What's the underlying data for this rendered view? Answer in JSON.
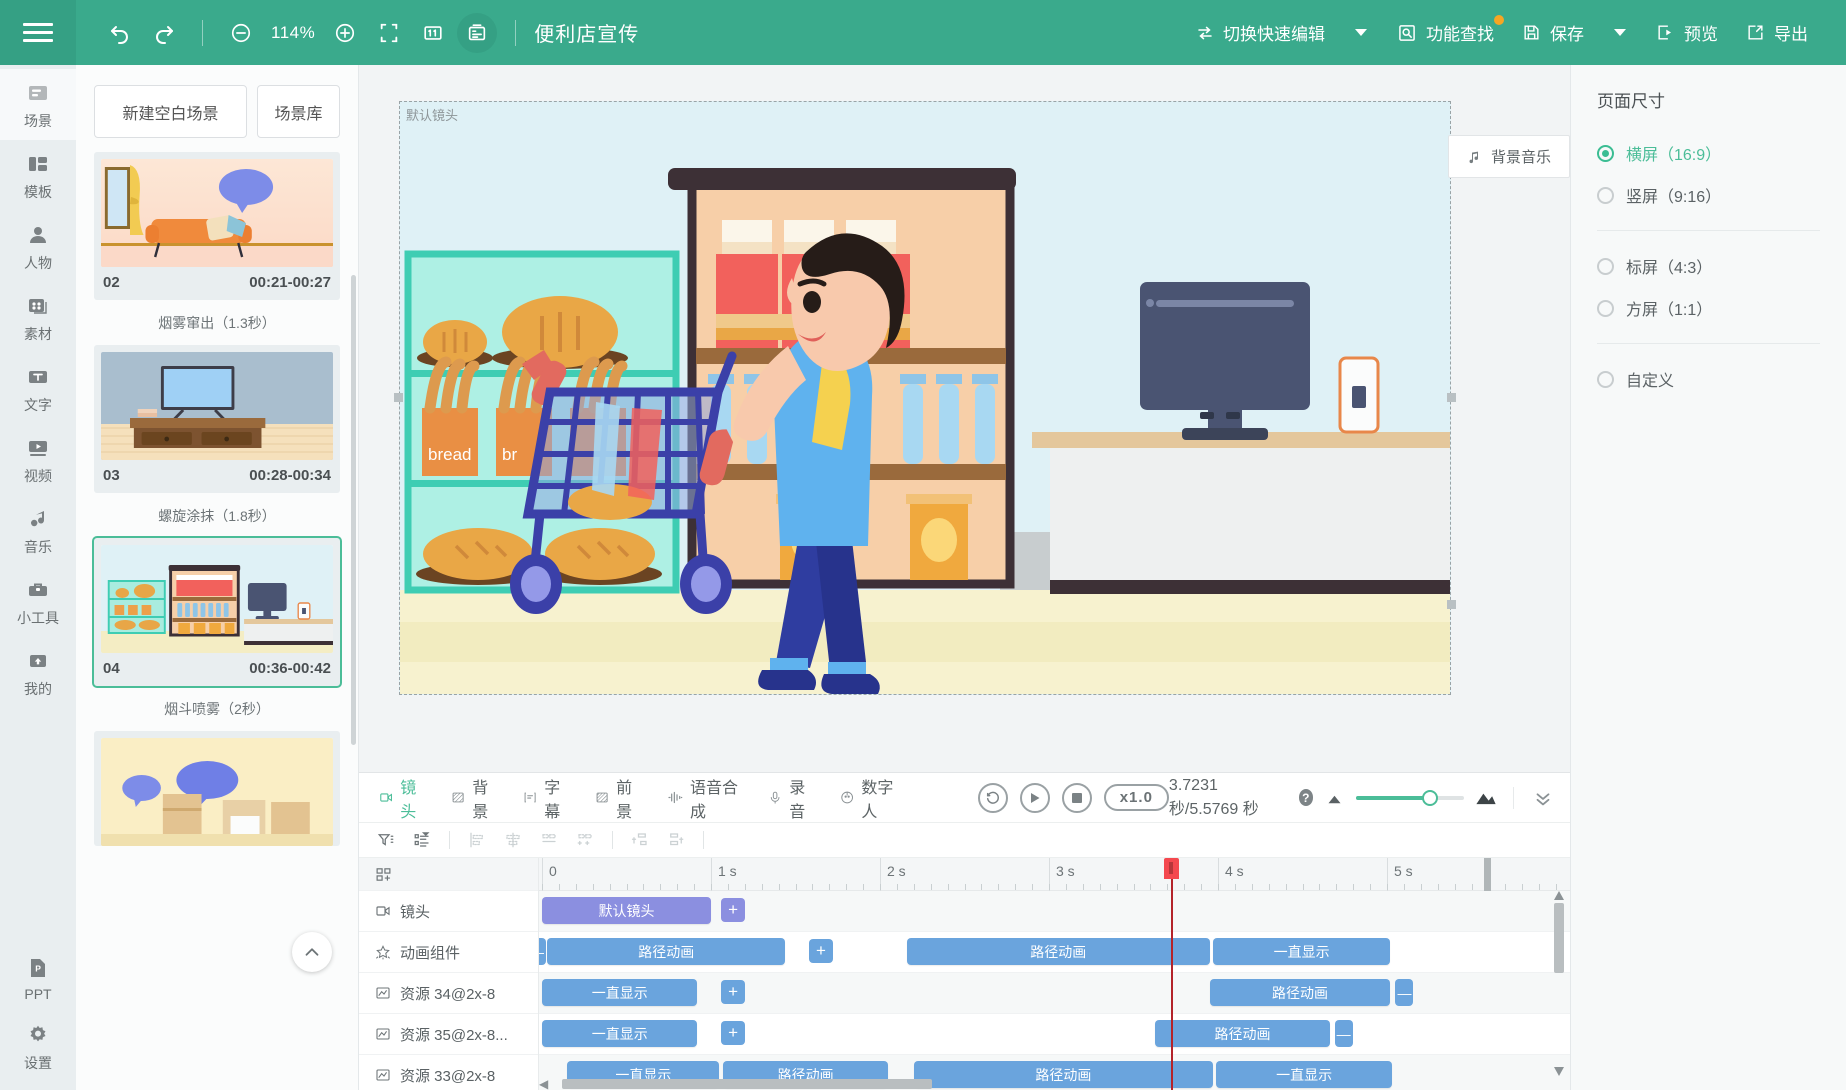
{
  "topbar": {
    "menu_icon": "hamburger-icon",
    "undo_icon": "undo-icon",
    "redo_icon": "redo-icon",
    "zoom_out_icon": "zoom-out-icon",
    "zoom_level": "114%",
    "zoom_in_icon": "zoom-in-icon",
    "fullscreen_icon": "fit-screen-icon",
    "one_to_one_icon": "actual-size-icon",
    "grid_icon": "storyboard-icon",
    "doc_title": "便利店宣传",
    "quick_edit": "切换快速编辑",
    "feature_search": "功能查找",
    "save": "保存",
    "preview": "预览",
    "export": "导出"
  },
  "rail": {
    "items": [
      {
        "label": "场景",
        "icon": "scene-icon"
      },
      {
        "label": "模板",
        "icon": "template-icon"
      },
      {
        "label": "人物",
        "icon": "person-icon"
      },
      {
        "label": "素材",
        "icon": "material-icon"
      },
      {
        "label": "文字",
        "icon": "text-icon"
      },
      {
        "label": "视频",
        "icon": "video-icon"
      },
      {
        "label": "音乐",
        "icon": "music-icon"
      },
      {
        "label": "小工具",
        "icon": "toolbox-icon"
      },
      {
        "label": "我的",
        "icon": "upload-icon"
      }
    ],
    "bottom": [
      {
        "label": "PPT",
        "icon": "ppt-icon"
      },
      {
        "label": "设置",
        "icon": "gear-icon"
      }
    ]
  },
  "scenes": {
    "new_blank": "新建空白场景",
    "library": "场景库",
    "items": [
      {
        "number": "02",
        "time": "00:21-00:27",
        "transition": "烟雾窜出（1.3秒）",
        "selected": false
      },
      {
        "number": "03",
        "time": "00:28-00:34",
        "transition": "螺旋涂抹（1.8秒）",
        "selected": false
      },
      {
        "number": "04",
        "time": "00:36-00:42",
        "transition": "烟斗喷雾（2秒）",
        "selected": true
      }
    ]
  },
  "stage": {
    "bgm_label": "背景音乐",
    "bgm_icon": "music-note-icon",
    "camera_label": "默认镜头"
  },
  "timeline": {
    "tabs": [
      {
        "label": "镜头",
        "icon": "camera-icon",
        "active": true
      },
      {
        "label": "背景",
        "icon": "background-icon",
        "active": false
      },
      {
        "label": "字幕",
        "icon": "subtitle-icon",
        "active": false
      },
      {
        "label": "前景",
        "icon": "foreground-icon",
        "active": false
      },
      {
        "label": "语音合成",
        "icon": "tts-icon",
        "active": false
      },
      {
        "label": "录音",
        "icon": "microphone-icon",
        "active": false
      },
      {
        "label": "数字人",
        "icon": "digital-human-icon",
        "active": false
      }
    ],
    "transport": {
      "replay_icon": "replay-icon",
      "play_icon": "play-icon",
      "stop_icon": "stop-icon",
      "speed": "x1.0"
    },
    "time_current": "3.7231 秒",
    "time_total": "5.5769 秒",
    "time_readout": "3.7231 秒/5.5769 秒",
    "help_icon": "question-icon",
    "zoom_small_icon": "small-hill-icon",
    "zoom_large_icon": "large-hill-icon",
    "collapse_icon": "double-chevron-down-icon",
    "tools": [
      "filter-tracks-icon",
      "group-tracks-icon",
      "align-left-icon",
      "align-center-icon",
      "align-right-icon",
      "distribute-icon",
      "nest-up-icon",
      "nest-down-icon"
    ],
    "ruler": {
      "labels": [
        "0",
        "1 s",
        "2 s",
        "3 s",
        "4 s",
        "5 s"
      ],
      "playhead_time": 3.7231
    },
    "header_row_icon": "track-group-icon",
    "tracks": [
      {
        "name": "镜头",
        "icon": "camera-track-icon",
        "clips": [
          {
            "label": "默认镜头",
            "start": 0.0,
            "end": 1.0,
            "kind": "cam"
          }
        ],
        "add_button": {
          "at": 1.06,
          "kind": "cam"
        }
      },
      {
        "name": "动画组件",
        "icon": "star-track-icon",
        "handles": [
          {
            "at": 0.0,
            "side": "left"
          }
        ],
        "clips": [
          {
            "label": "路径动画",
            "start": 0.03,
            "end": 1.44,
            "kind": "anim"
          },
          {
            "label": "路径动画",
            "start": 2.16,
            "end": 3.95,
            "kind": "anim"
          },
          {
            "label": "一直显示",
            "start": 3.97,
            "end": 5.02,
            "kind": "anim"
          }
        ],
        "add_button": {
          "at": 1.58,
          "kind": "anim"
        }
      },
      {
        "name": "资源 34@2x-8",
        "icon": "resource-track-icon",
        "clips": [
          {
            "label": "一直显示",
            "start": 0.0,
            "end": 0.92,
            "kind": "anim"
          },
          {
            "label": "路径动画",
            "start": 3.95,
            "end": 5.02,
            "kind": "anim"
          }
        ],
        "add_button": {
          "at": 1.06,
          "kind": "anim"
        },
        "minus_button": {
          "at": 5.05
        }
      },
      {
        "name": "资源 35@2x-8...",
        "icon": "resource-track-icon",
        "clips": [
          {
            "label": "一直显示",
            "start": 0.0,
            "end": 0.92,
            "kind": "anim"
          },
          {
            "label": "路径动画",
            "start": 3.63,
            "end": 4.66,
            "kind": "anim"
          }
        ],
        "add_button": {
          "at": 1.06,
          "kind": "anim"
        },
        "minus_button": {
          "at": 4.69
        }
      },
      {
        "name": "资源 33@2x-8",
        "icon": "resource-track-icon",
        "clips": [
          {
            "label": "一直显示",
            "start": 0.15,
            "end": 1.05,
            "kind": "anim"
          },
          {
            "label": "路径动画",
            "start": 1.07,
            "end": 2.05,
            "kind": "anim"
          },
          {
            "label": "路径动画",
            "start": 2.2,
            "end": 3.97,
            "kind": "anim"
          },
          {
            "label": "一直显示",
            "start": 3.99,
            "end": 5.03,
            "kind": "anim"
          }
        ]
      }
    ]
  },
  "rightpanel": {
    "title": "页面尺寸",
    "options": [
      {
        "label": "横屏（16:9）",
        "selected": true
      },
      {
        "label": "竖屏（9:16）",
        "selected": false
      },
      {
        "label": "标屏（4:3）",
        "selected": false
      },
      {
        "label": "方屏（1:1）",
        "selected": false
      },
      {
        "label": "自定义",
        "selected": false
      }
    ]
  },
  "colors": {
    "brand": "#3aaa8c",
    "accent_green": "#4bbd98",
    "clip_blue": "#6aa4dd",
    "clip_purple": "#8b8fe0",
    "playhead_red": "#f4484f",
    "badge_orange": "#f6a623"
  }
}
